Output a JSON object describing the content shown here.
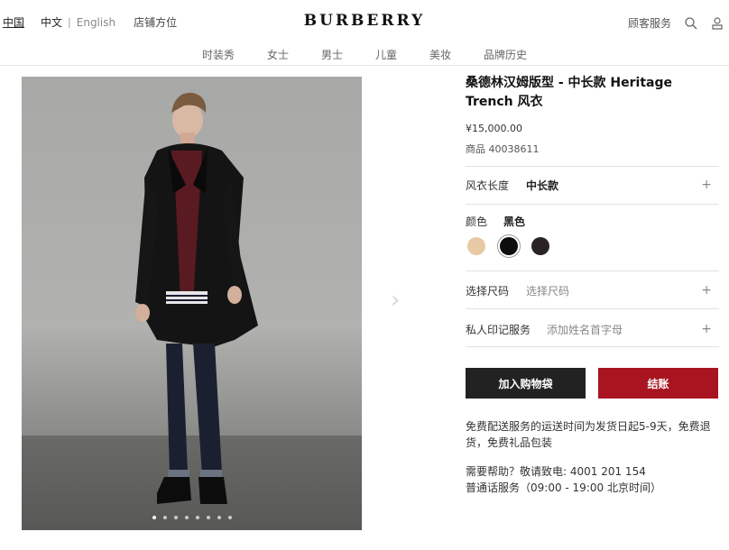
{
  "header": {
    "locale_country": "中国",
    "locale_lang_zh": "中文",
    "locale_separator": "|",
    "locale_lang_en": "English",
    "stores": "店铺方位",
    "logo": "BURBERRY",
    "customer_service": "顾客服务",
    "icons": [
      "search-icon",
      "user-icon"
    ]
  },
  "nav": {
    "items": [
      {
        "label": "时装秀"
      },
      {
        "label": "女士"
      },
      {
        "label": "男士"
      },
      {
        "label": "儿童"
      },
      {
        "label": "美妆"
      },
      {
        "label": "品牌历史"
      }
    ]
  },
  "gallery": {
    "image_count": 8,
    "active_index": 0,
    "next_icon": "chevron-right-icon"
  },
  "product": {
    "title": "桑德林汉姆版型 - 中长款 Heritage Trench 风衣",
    "price": "¥15,000.00",
    "sku": "商品 40038611",
    "length_label": "风衣长度",
    "length_value": "中长款",
    "color_label": "颜色",
    "color_value": "黑色",
    "colors": [
      {
        "name": "honey",
        "hex": "#e8c9a6"
      },
      {
        "name": "black",
        "hex": "#0d0d0d"
      },
      {
        "name": "dark",
        "hex": "#2a2326"
      }
    ],
    "size_label": "选择尺码",
    "size_placeholder": "选择尺码",
    "monogram_label": "私人印记服务",
    "monogram_placeholder": "添加姓名首字母",
    "plus": "+"
  },
  "actions": {
    "add_to_bag": "加入购物袋",
    "checkout": "结账",
    "add_color": "#222222",
    "checkout_color": "#a8141f"
  },
  "notes": {
    "shipping": "免费配送服务的运送时间为发货日起5-9天，免费退货，免费礼品包装",
    "help": "需要帮助？敬请致电: 4001 201 154",
    "hours": "普通话服务（09:00 - 19:00 北京时间）"
  }
}
